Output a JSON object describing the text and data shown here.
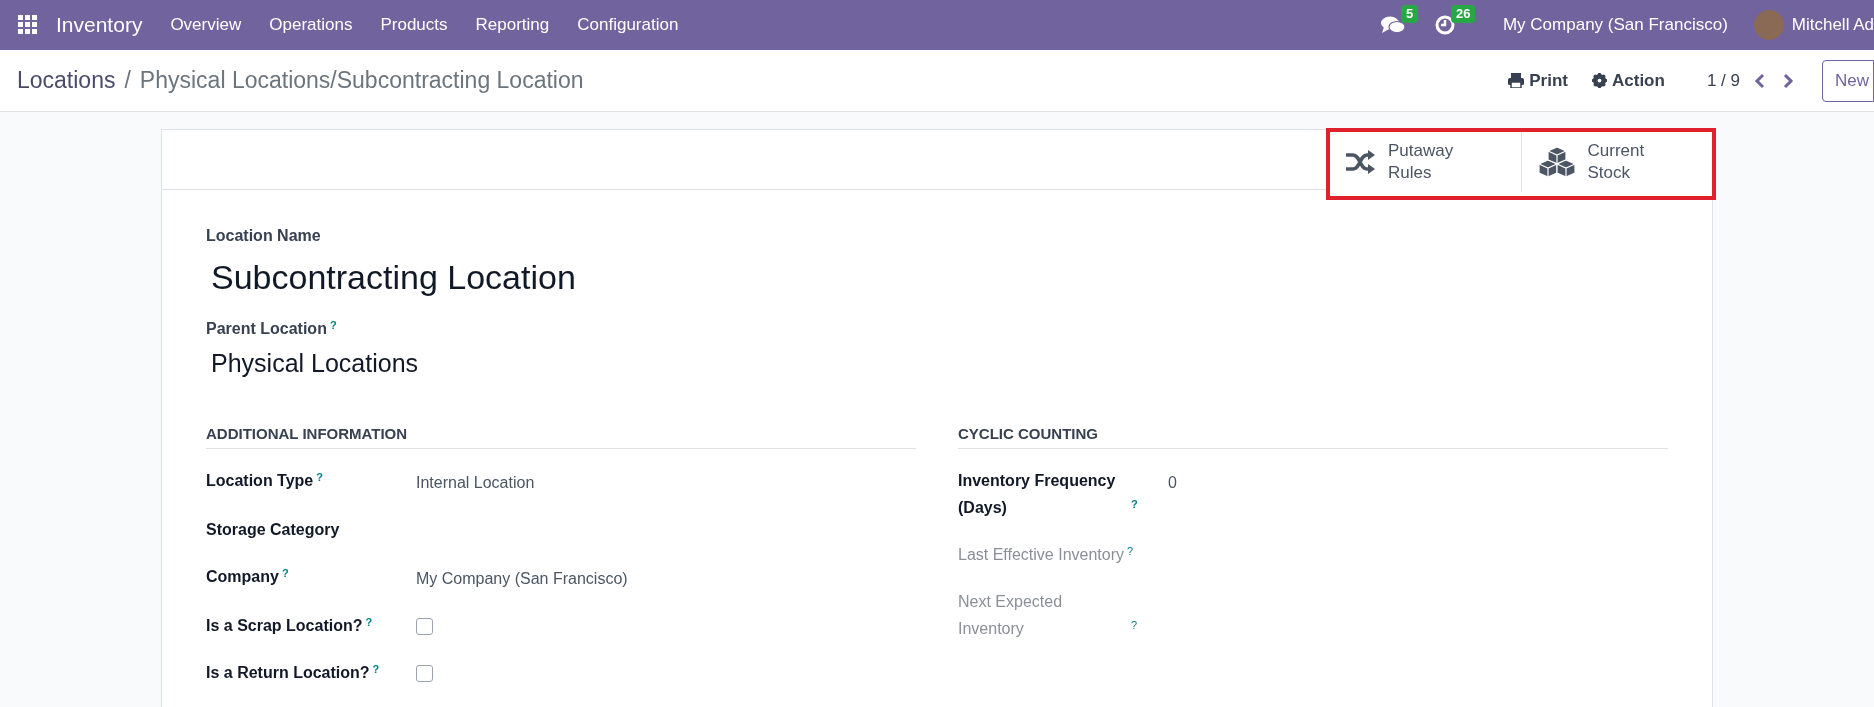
{
  "navbar": {
    "app": "Inventory",
    "menu": [
      "Overview",
      "Operations",
      "Products",
      "Reporting",
      "Configuration"
    ],
    "messages_count": "5",
    "activities_count": "26",
    "company": "My Company (San Francisco)",
    "user": "Mitchell Ad"
  },
  "control_panel": {
    "breadcrumb_parent": "Locations",
    "breadcrumb_separator": "/",
    "breadcrumb_current": "Physical Locations/Subcontracting Location",
    "print": "Print",
    "action": "Action",
    "pager": "1 / 9",
    "new_button": "New"
  },
  "smart_buttons": [
    {
      "kind": "shuffle",
      "label": "Putaway Rules"
    },
    {
      "kind": "cubes",
      "label": "Current Stock"
    }
  ],
  "form": {
    "name_label": "Location Name",
    "name": "Subcontracting Location",
    "parent_label": "Parent Location",
    "parent_help": "?",
    "parent": "Physical Locations",
    "sections": [
      {
        "title": "ADDITIONAL INFORMATION",
        "fields": [
          {
            "kind": "text",
            "label": "Location Type",
            "help": "?",
            "value": "Internal Location",
            "readonly": false
          },
          {
            "kind": "text",
            "label": "Storage Category",
            "readonly": false
          },
          {
            "kind": "text",
            "label": "Company",
            "help": "?",
            "value": "My Company (San Francisco)",
            "readonly": false
          },
          {
            "kind": "checkbox",
            "label": "Is a Scrap Location?",
            "help": "?",
            "checked": false,
            "readonly": false
          },
          {
            "kind": "checkbox",
            "label": "Is a Return Location?",
            "help": "?",
            "checked": false,
            "readonly": false
          }
        ]
      },
      {
        "title": "CYCLIC COUNTING",
        "fields": [
          {
            "kind": "text",
            "label": "Inventory Frequency (Days)",
            "help": "?",
            "value": "0",
            "readonly": false
          },
          {
            "kind": "text",
            "label": "Last Effective Inventory",
            "help": "?",
            "readonly": true
          },
          {
            "kind": "text",
            "label": "Next Expected Inventory",
            "help": "?",
            "readonly": true
          }
        ]
      }
    ]
  }
}
